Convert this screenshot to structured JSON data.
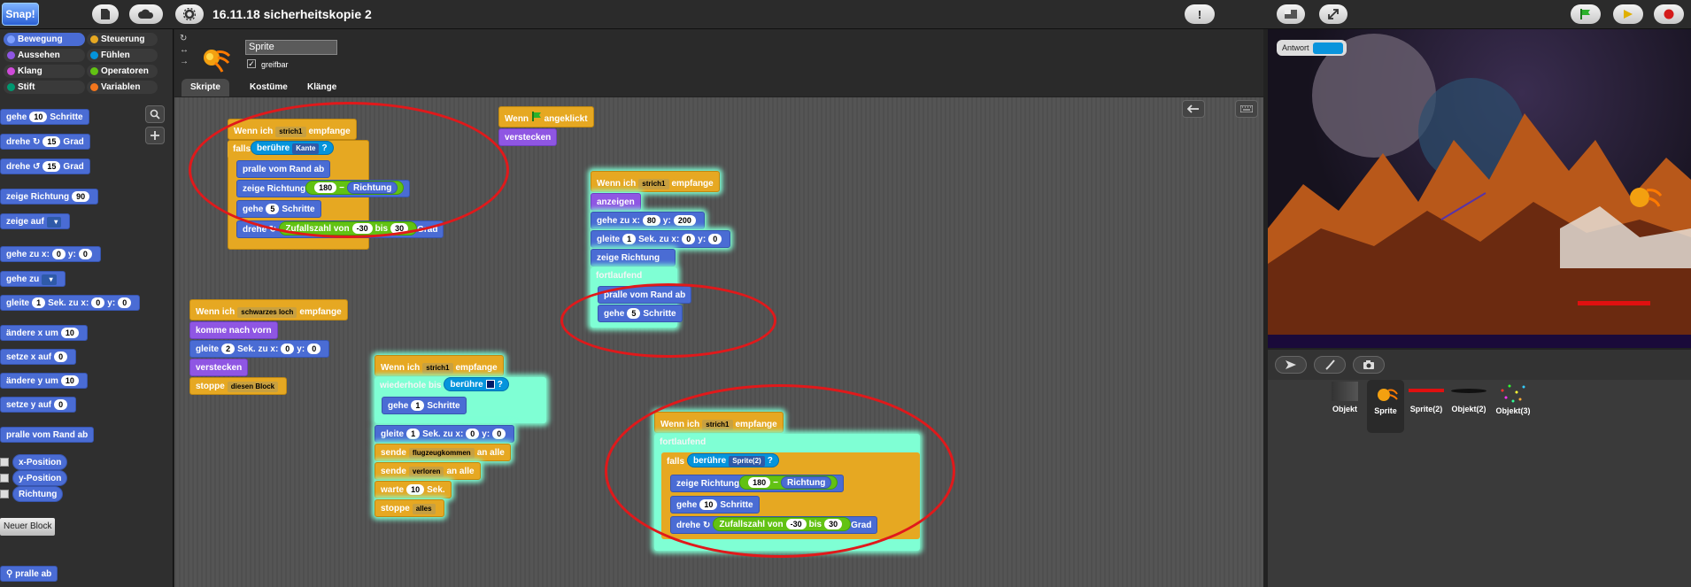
{
  "app": {
    "logo": "Snap!",
    "project_title": "16.11.18 sicherheitskopie 2"
  },
  "toolbar": {
    "file_icon": "file-icon",
    "cloud_icon": "cloud-icon",
    "settings_icon": "gear-icon",
    "alert_label": "!",
    "stage_size_icon": "stage-size-icon",
    "fullscreen_icon": "fullscreen-icon",
    "green_flag_icon": "green-flag-icon",
    "pause_icon": "pause-icon",
    "stop_icon": "stop-icon"
  },
  "categories": [
    {
      "label": "Bewegung",
      "color": "#4a6cd4",
      "selected": true
    },
    {
      "label": "Steuerung",
      "color": "#e6a822"
    },
    {
      "label": "Aussehen",
      "color": "#8f56e3"
    },
    {
      "label": "Fühlen",
      "color": "#0494dc"
    },
    {
      "label": "Klang",
      "color": "#cf4ad9"
    },
    {
      "label": "Operatoren",
      "color": "#62c213"
    },
    {
      "label": "Stift",
      "color": "#009870"
    },
    {
      "label": "Variablen",
      "color": "#f3761d"
    }
  ],
  "palette": {
    "gehe": "gehe",
    "gehe_val": "10",
    "schritte": "Schritte",
    "drehe": "drehe",
    "drehe_r_val": "15",
    "grad": "Grad",
    "drehe_l_val": "15",
    "zeige_richtung": "zeige Richtung",
    "zeige_richtung_val": "90",
    "zeige_auf": "zeige auf",
    "gehe_zu_x": "gehe zu x:",
    "gehe_zu_x_val": "0",
    "y": "y:",
    "gehe_zu_y_val": "0",
    "gehe_zu": "gehe zu",
    "gleite": "gleite",
    "gleite_val": "1",
    "sek_zu_x": "Sek. zu x:",
    "gleite_x": "0",
    "gleite_y": "0",
    "aendere_x": "ändere x um",
    "aendere_x_val": "10",
    "setze_x": "setze x auf",
    "setze_x_val": "0",
    "aendere_y": "ändere y um",
    "aendere_y_val": "10",
    "setze_y": "setze y auf",
    "setze_y_val": "0",
    "pralle": "pralle vom Rand ab",
    "x_position": "x-Position",
    "y_position": "y-Position",
    "richtung": "Richtung",
    "neuer_block": "Neuer Block",
    "pralle_ab": "pralle ab"
  },
  "sprite": {
    "name": "Sprite",
    "draggable_label": "greifbar",
    "draggable_checked": "✓"
  },
  "tabs": [
    "Skripte",
    "Kostüme",
    "Klänge"
  ],
  "scripts": {
    "s1": {
      "hat": "Wenn ich",
      "msg": "strich1",
      "empfange": "empfange",
      "falls": "falls",
      "beruehre": "berühre",
      "kante": "Kante",
      "q": "?",
      "pralle": "pralle vom Rand ab",
      "zeige": "zeige Richtung",
      "v180": "180",
      "minus": "−",
      "richtung": "Richtung",
      "gehe": "gehe",
      "v5": "5",
      "schritte": "Schritte",
      "drehe": "drehe",
      "zufall": "Zufallszahl von",
      "vm30": "-30",
      "bis": "bis",
      "v30": "30",
      "grad": "Grad"
    },
    "s2": {
      "hat1": "Wenn",
      "hat2": "angeklickt",
      "verstecken": "verstecken"
    },
    "s3": {
      "hat": "Wenn ich",
      "msg": "strich1",
      "empfange": "empfange",
      "anzeigen": "anzeigen",
      "gehe_zu": "gehe zu x:",
      "x": "80",
      "y": "y:",
      "yv": "200",
      "gleite": "gleite",
      "g1": "1",
      "sek": "Sek. zu x:",
      "gx": "0",
      "gy": "0",
      "zeige": "zeige Richtung",
      "fortlaufend": "fortlaufend",
      "pralle": "pralle vom Rand ab",
      "gehe": "gehe",
      "v5": "5",
      "schritte": "Schritte"
    },
    "s4": {
      "hat": "Wenn ich",
      "msg": "schwarzes loch",
      "empfange": "empfange",
      "komme": "komme nach vorn",
      "gleite": "gleite",
      "g2": "2",
      "sek": "Sek. zu x:",
      "gx": "0",
      "y": "y:",
      "gy": "0",
      "verstecken": "verstecken",
      "stoppe": "stoppe",
      "diesen": "diesen Block"
    },
    "s5": {
      "hat": "Wenn ich",
      "msg": "strich1",
      "empfange": "empfange",
      "wiederhole": "wiederhole bis",
      "beruehre": "berühre",
      "q": "?",
      "gehe": "gehe",
      "v1": "1",
      "schritte": "Schritte",
      "gleite": "gleite",
      "g1": "1",
      "sek": "Sek. zu x:",
      "gx": "0",
      "y": "y:",
      "gy": "0",
      "sende": "sende",
      "flug": "flugzeugkommen",
      "an_alle": "an alle",
      "sende2": "sende",
      "verloren": "verloren",
      "an_alle2": "an alle",
      "warte": "warte",
      "w10": "10",
      "sekp": "Sek.",
      "stoppe": "stoppe",
      "alles": "alles"
    },
    "s6": {
      "hat": "Wenn ich",
      "msg": "strich1",
      "empfange": "empfange",
      "fortlaufend": "fortlaufend",
      "falls": "falls",
      "beruehre": "berühre",
      "sprite2": "Sprite(2)",
      "q": "?",
      "zeige": "zeige Richtung",
      "v180": "180",
      "minus": "−",
      "richtung": "Richtung",
      "gehe": "gehe",
      "v10": "10",
      "schritte": "Schritte",
      "drehe": "drehe",
      "zufall": "Zufallszahl von",
      "vm30": "-30",
      "bis": "bis",
      "v30": "30",
      "grad": "Grad"
    }
  },
  "stage": {
    "watcher_label": "Antwort"
  },
  "corral": {
    "sprites": [
      {
        "name": "Objekt"
      },
      {
        "name": "Sprite",
        "selected": true
      },
      {
        "name": "Sprite(2)"
      },
      {
        "name": "Objekt(2)"
      },
      {
        "name": "Objekt(3)"
      }
    ]
  },
  "colors": {
    "annotation_ring": "#e0191b",
    "glow": "#7fffd4"
  }
}
